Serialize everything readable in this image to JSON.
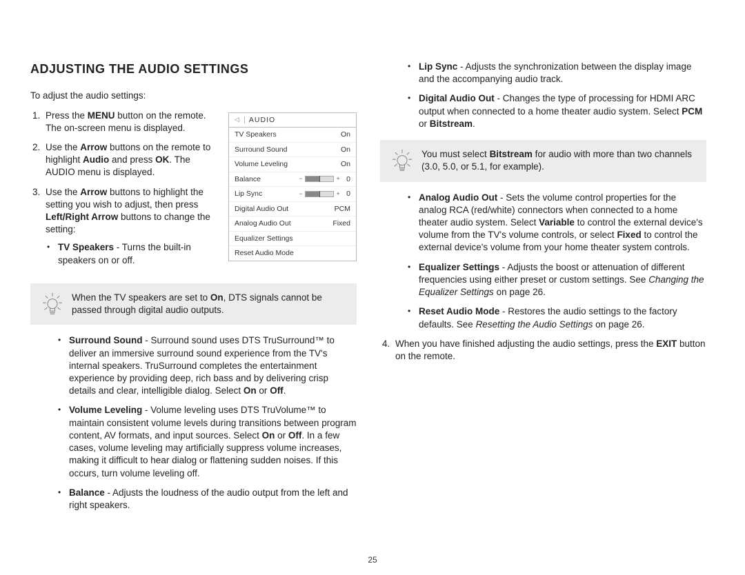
{
  "title": "ADJUSTING THE AUDIO SETTINGS",
  "intro": "To adjust the audio settings:",
  "step1": {
    "a": "Press the ",
    "menu": "MENU",
    "b": " button on the remote. The on-screen menu is displayed."
  },
  "step2": {
    "a": "Use the ",
    "arrow": "Arrow",
    "b": " buttons on the remote to highlight ",
    "audio": "Audio",
    "c": " and press ",
    "ok": "OK",
    "d": ". The AUDIO menu is displayed."
  },
  "step3": {
    "a": "Use the ",
    "arrow": "Arrow",
    "b": " buttons to highlight the setting you wish to adjust, then press ",
    "lr": "Left/Right Arrow",
    "c": " buttons to change the setting:"
  },
  "tvspk": {
    "name": "TV Speakers",
    "desc": " - Turns the built-in speakers on or off."
  },
  "tip1": {
    "a": "When the TV speakers are set to ",
    "on": "On",
    "b": ", DTS signals cannot be passed through digital audio outputs."
  },
  "surround": {
    "name": "Surround Sound",
    "a": " - Surround sound uses DTS TruSurround™ to deliver an immersive surround sound experience from the TV's internal speakers. TruSurround completes the entertainment experience by providing deep, rich bass and by delivering crisp details and clear, intelligible dialog. Select ",
    "on": "On",
    "or": " or ",
    "off": "Off",
    "dot": "."
  },
  "volume": {
    "name": "Volume Leveling",
    "a": " - Volume leveling uses DTS TruVolume™ to maintain consistent volume levels during transitions between program content, AV formats, and input sources. Select ",
    "on": "On",
    "or": " or ",
    "off": "Off",
    "b": ". In a few cases, volume leveling may artificially suppress volume increases, making it difficult to hear dialog or flattening sudden noises. If this occurs, turn volume leveling off."
  },
  "balance": {
    "name": "Balance",
    "desc": " - Adjusts the loudness of the audio output from the left and right speakers."
  },
  "lipsync": {
    "name": "Lip Sync",
    "desc": " - Adjusts the synchronization between the display image and the accompanying audio track."
  },
  "dao": {
    "name": "Digital Audio Out",
    "a": " - Changes the type of processing for HDMI ARC output when connected to a home theater audio system. Select ",
    "pcm": "PCM",
    "or": " or ",
    "bs": "Bitstream",
    "dot": "."
  },
  "tip2": {
    "a": "You must select ",
    "bs": "Bitstream",
    "b": " for audio with more than two channels (3.0, 5.0, or 5.1, for example)."
  },
  "aao": {
    "name": "Analog Audio Out",
    "a": " - Sets the volume control properties for the analog RCA (red/white) connectors when connected to a home theater audio system. Select ",
    "var": "Variable",
    "b": " to control the external device's volume from the TV's volume controls, or select ",
    "fix": "Fixed",
    "c": " to control the external device's volume from your home theater system controls."
  },
  "eq": {
    "name": "Equalizer Settings",
    "a": " - Adjusts the boost or attenuation of different frequencies using either preset or custom settings. See ",
    "ref": "Changing the Equalizer Settings",
    "b": " on page 26."
  },
  "reset": {
    "name": "Reset Audio Mode",
    "a": " - Restores the audio settings to the factory defaults. See ",
    "ref": "Resetting the Audio Settings",
    "b": " on page 26."
  },
  "step4": {
    "a": "When you have finished adjusting the audio settings, press the ",
    "exit": "EXIT",
    "b": " button on the remote."
  },
  "menu": {
    "header": "AUDIO",
    "rows": {
      "tvspk": {
        "label": "TV Speakers",
        "value": "On"
      },
      "ss": {
        "label": "Surround Sound",
        "value": "On"
      },
      "vl": {
        "label": "Volume Leveling",
        "value": "On"
      },
      "bal": {
        "label": "Balance",
        "value": "0"
      },
      "lip": {
        "label": "Lip Sync",
        "value": "0"
      },
      "dao": {
        "label": "Digital Audio Out",
        "value": "PCM"
      },
      "aao": {
        "label": "Analog Audio Out",
        "value": "Fixed"
      },
      "eq": {
        "label": "Equalizer Settings"
      },
      "reset": {
        "label": "Reset Audio Mode"
      }
    }
  },
  "page_number": "25"
}
